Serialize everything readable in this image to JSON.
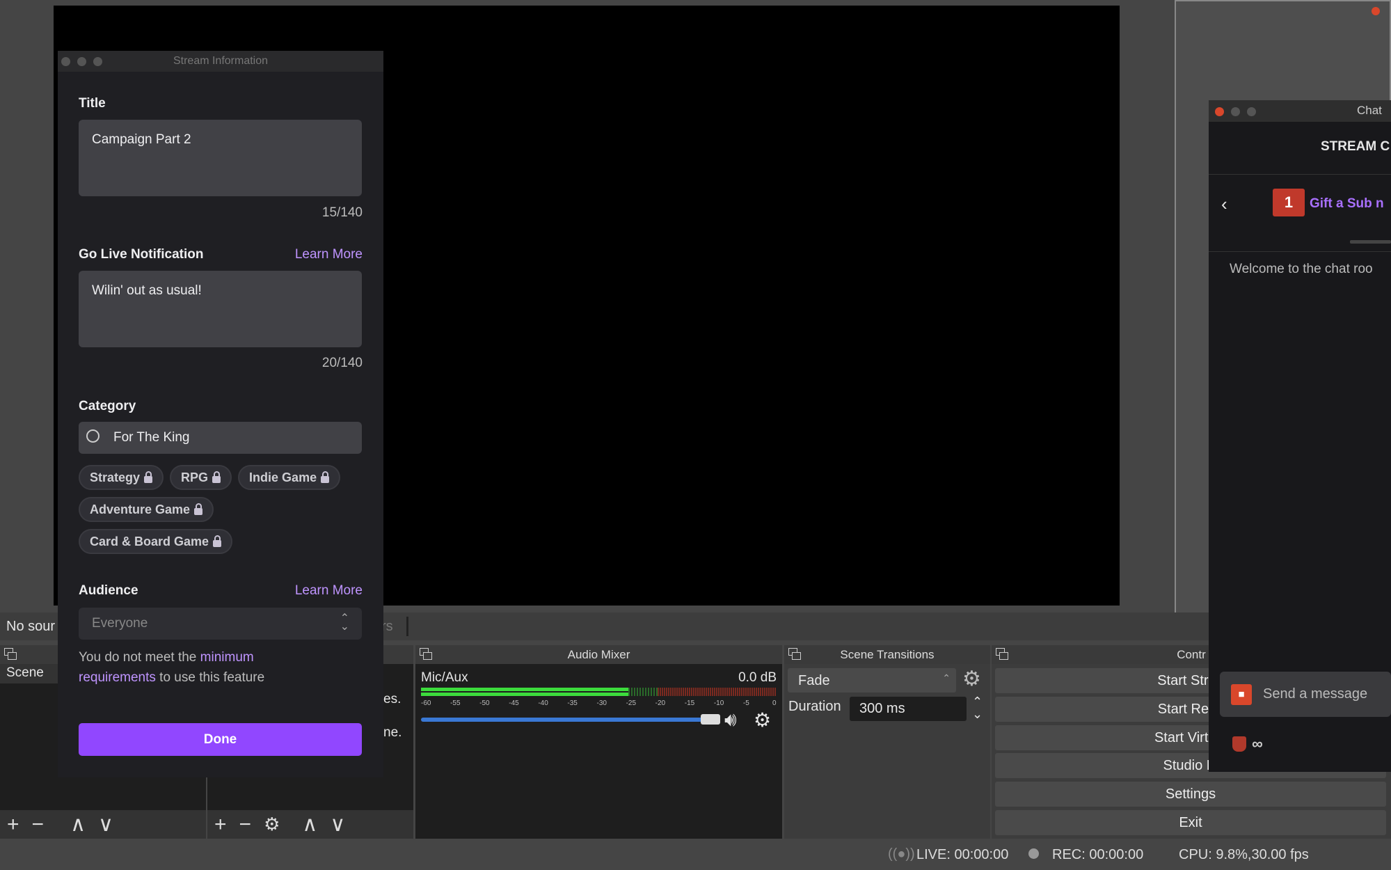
{
  "colors": {
    "accent": "#9147ff",
    "link": "#bf94ff",
    "meter_green": "#3cdc3c",
    "meter_red": "#c0392b",
    "volume_blue": "#3a78d4",
    "close_red": "#d9472b"
  },
  "obs": {
    "sources_bar": {
      "no_source_text": "No sour",
      "filters_partial": "rs"
    },
    "docks": {
      "scenes_item": "Scene",
      "sources_partial": [
        "es.",
        "ne."
      ],
      "audio_mixer": "Audio Mixer",
      "scene_transitions": "Scene Transitions",
      "controls": "Contr"
    },
    "audio": {
      "channel": "Mic/Aux",
      "db": "0.0 dB",
      "scale": [
        "-60",
        "-55",
        "-50",
        "-45",
        "-40",
        "-35",
        "-30",
        "-25",
        "-20",
        "-15",
        "-10",
        "-5",
        "0"
      ],
      "volume_percent": 100
    },
    "transitions": {
      "selected": "Fade",
      "duration_label": "Duration",
      "duration_value": "300 ms"
    },
    "controls": [
      "Start Strea",
      "Start Reco",
      "Start Virtual",
      "Studio M",
      "Settings",
      "Exit"
    ],
    "status": {
      "live": "LIVE: 00:00:00",
      "rec": "REC: 00:00:00",
      "cpu": "CPU: 9.8%,30.00 fps"
    }
  },
  "dialog": {
    "window_title": "Stream Information",
    "title_label": "Title",
    "title_value": "Campaign Part 2",
    "title_count": "15/140",
    "notif_label": "Go Live Notification",
    "learn_more": "Learn More",
    "notif_value": "Wilin' out as usual!",
    "notif_count": "20/140",
    "category_label": "Category",
    "category_value": "For The King",
    "tags": [
      "Strategy",
      "RPG",
      "Indie Game",
      "Adventure Game",
      "Card & Board Game"
    ],
    "audience_label": "Audience",
    "audience_value": "Everyone",
    "msg_prefix": "You do not meet the ",
    "msg_link1": "minimum",
    "msg_link2": "requirements",
    "msg_suffix": " to use this feature",
    "done": "Done"
  },
  "chat": {
    "window_title": "Chat",
    "header": "STREAM C",
    "gift_text": "Gift a Sub n",
    "welcome": "Welcome to the chat roo",
    "send_placeholder": "Send a message",
    "bits": "∞"
  }
}
